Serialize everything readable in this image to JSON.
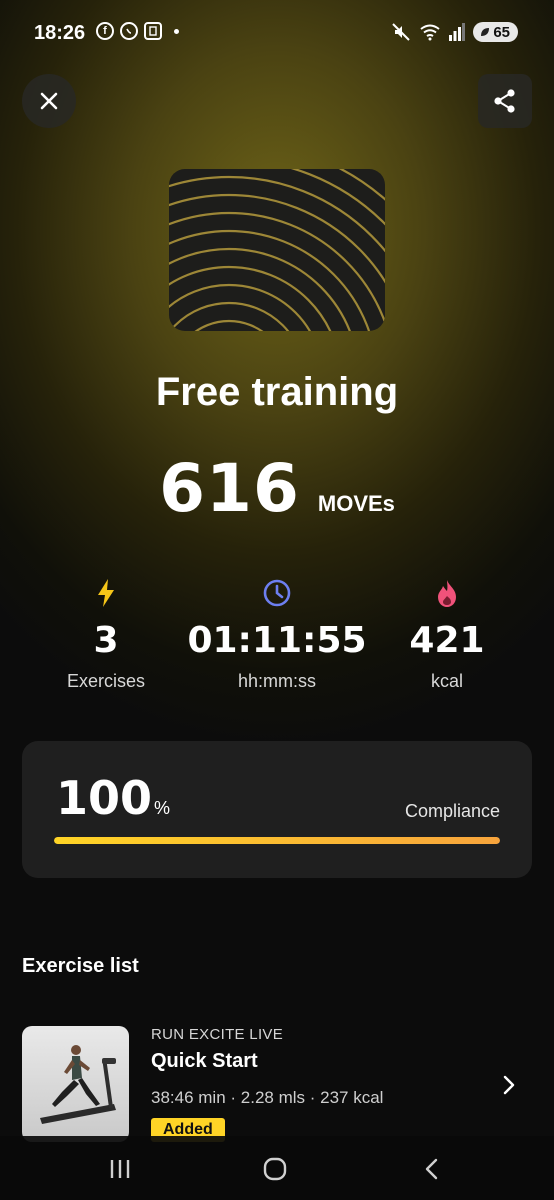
{
  "status_bar": {
    "time": "18:26",
    "battery": "65",
    "left_icons": [
      "facebook-icon",
      "whatsapp-icon",
      "clipboard-icon"
    ],
    "right_icons": [
      "mute-icon",
      "wifi-icon",
      "signal-icon",
      "battery-icon"
    ]
  },
  "header": {
    "close_icon": "close-icon",
    "share_icon": "share-icon"
  },
  "workout": {
    "title": "Free training",
    "moves_value": "616",
    "moves_unit": "MOVEs"
  },
  "stats": [
    {
      "icon": "bolt-icon",
      "value": "3",
      "label": "Exercises",
      "color": "#f5c518"
    },
    {
      "icon": "clock-icon",
      "value": "01:11:55",
      "label": "hh:mm:ss",
      "color": "#6d7ff0"
    },
    {
      "icon": "flame-icon",
      "value": "421",
      "label": "kcal",
      "color": "#f0527a"
    }
  ],
  "compliance": {
    "value": "100",
    "unit": "%",
    "label": "Compliance",
    "progress_fraction": 1.0
  },
  "exercise_list": {
    "title": "Exercise list",
    "items": [
      {
        "brand": "RUN EXCITE LIVE",
        "name": "Quick Start",
        "meta": "38:46 min · 2.28 mls · 237 kcal",
        "badge": "Added"
      }
    ]
  },
  "colors": {
    "accent_yellow": "#ffd426",
    "accent_orange": "#f7a43c",
    "card_bg": "#1f1f1f"
  }
}
